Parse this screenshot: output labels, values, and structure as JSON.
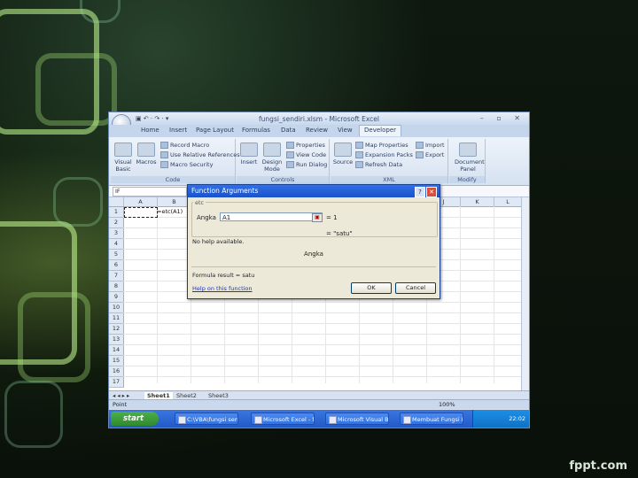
{
  "branding": {
    "site": "fppt.com"
  },
  "window": {
    "title": "fungsi_sendiri.xlsm - Microsoft Excel",
    "quick_access": "▣ ↶ · ↷ · ▾",
    "controls": "– ▫ ✕"
  },
  "ribbon": {
    "tabs": [
      "Home",
      "Insert",
      "Page Layout",
      "Formulas",
      "Data",
      "Review",
      "View",
      "Developer"
    ],
    "active_tab": "Developer",
    "groups": {
      "code": {
        "label": "Code",
        "visual_basic": "Visual Basic",
        "macros": "Macros",
        "record_macro": "Record Macro",
        "relative_refs": "Use Relative References",
        "macro_security": "Macro Security"
      },
      "controls": {
        "label": "Controls",
        "insert": "Insert",
        "design_mode": "Design Mode",
        "properties": "Properties",
        "view_code": "View Code",
        "run_dialog": "Run Dialog"
      },
      "xml": {
        "label": "XML",
        "source": "Source",
        "map_properties": "Map Properties",
        "expansion_packs": "Expansion Packs",
        "refresh_data": "Refresh Data",
        "import": "Import",
        "export": "Export"
      },
      "modify": {
        "label": "Modify",
        "document_panel": "Document Panel"
      }
    }
  },
  "formula_bar": {
    "name_box": "IF"
  },
  "sheet": {
    "columns": [
      "A",
      "B",
      "C",
      "D",
      "E",
      "F",
      "G",
      "H",
      "I",
      "J",
      "K",
      "L"
    ],
    "rows": [
      "1",
      "2",
      "3",
      "4",
      "5",
      "6",
      "7",
      "8",
      "9",
      "10",
      "11",
      "12",
      "13",
      "14",
      "15",
      "16",
      "17"
    ],
    "cell_b1": "=etc(A1)"
  },
  "sheet_tabs": {
    "sheet1": "Sheet1",
    "sheet2": "Sheet2",
    "sheet3": "Sheet3"
  },
  "status_bar": {
    "mode": "Point",
    "zoom": "100%"
  },
  "dialog": {
    "title": "Function Arguments",
    "help_btn": "?",
    "close_btn": "✕",
    "function_name": "etc",
    "arg_label": "Angka",
    "arg_value": "A1",
    "arg_result": "= 1",
    "return_value": "= \"satu\"",
    "no_help": "No help available.",
    "arg_description": "Angka",
    "formula_result": "Formula result = satu",
    "help_link": "Help on this function",
    "ok_label": "OK",
    "cancel_label": "Cancel"
  },
  "taskbar": {
    "start_label": "start",
    "items": [
      "C:\\VBA\\fungsi sen...",
      "Microsoft Excel - f...",
      "Microsoft Visual Ba...",
      "Membuat Fungsi D..."
    ],
    "clock": "22:02"
  }
}
